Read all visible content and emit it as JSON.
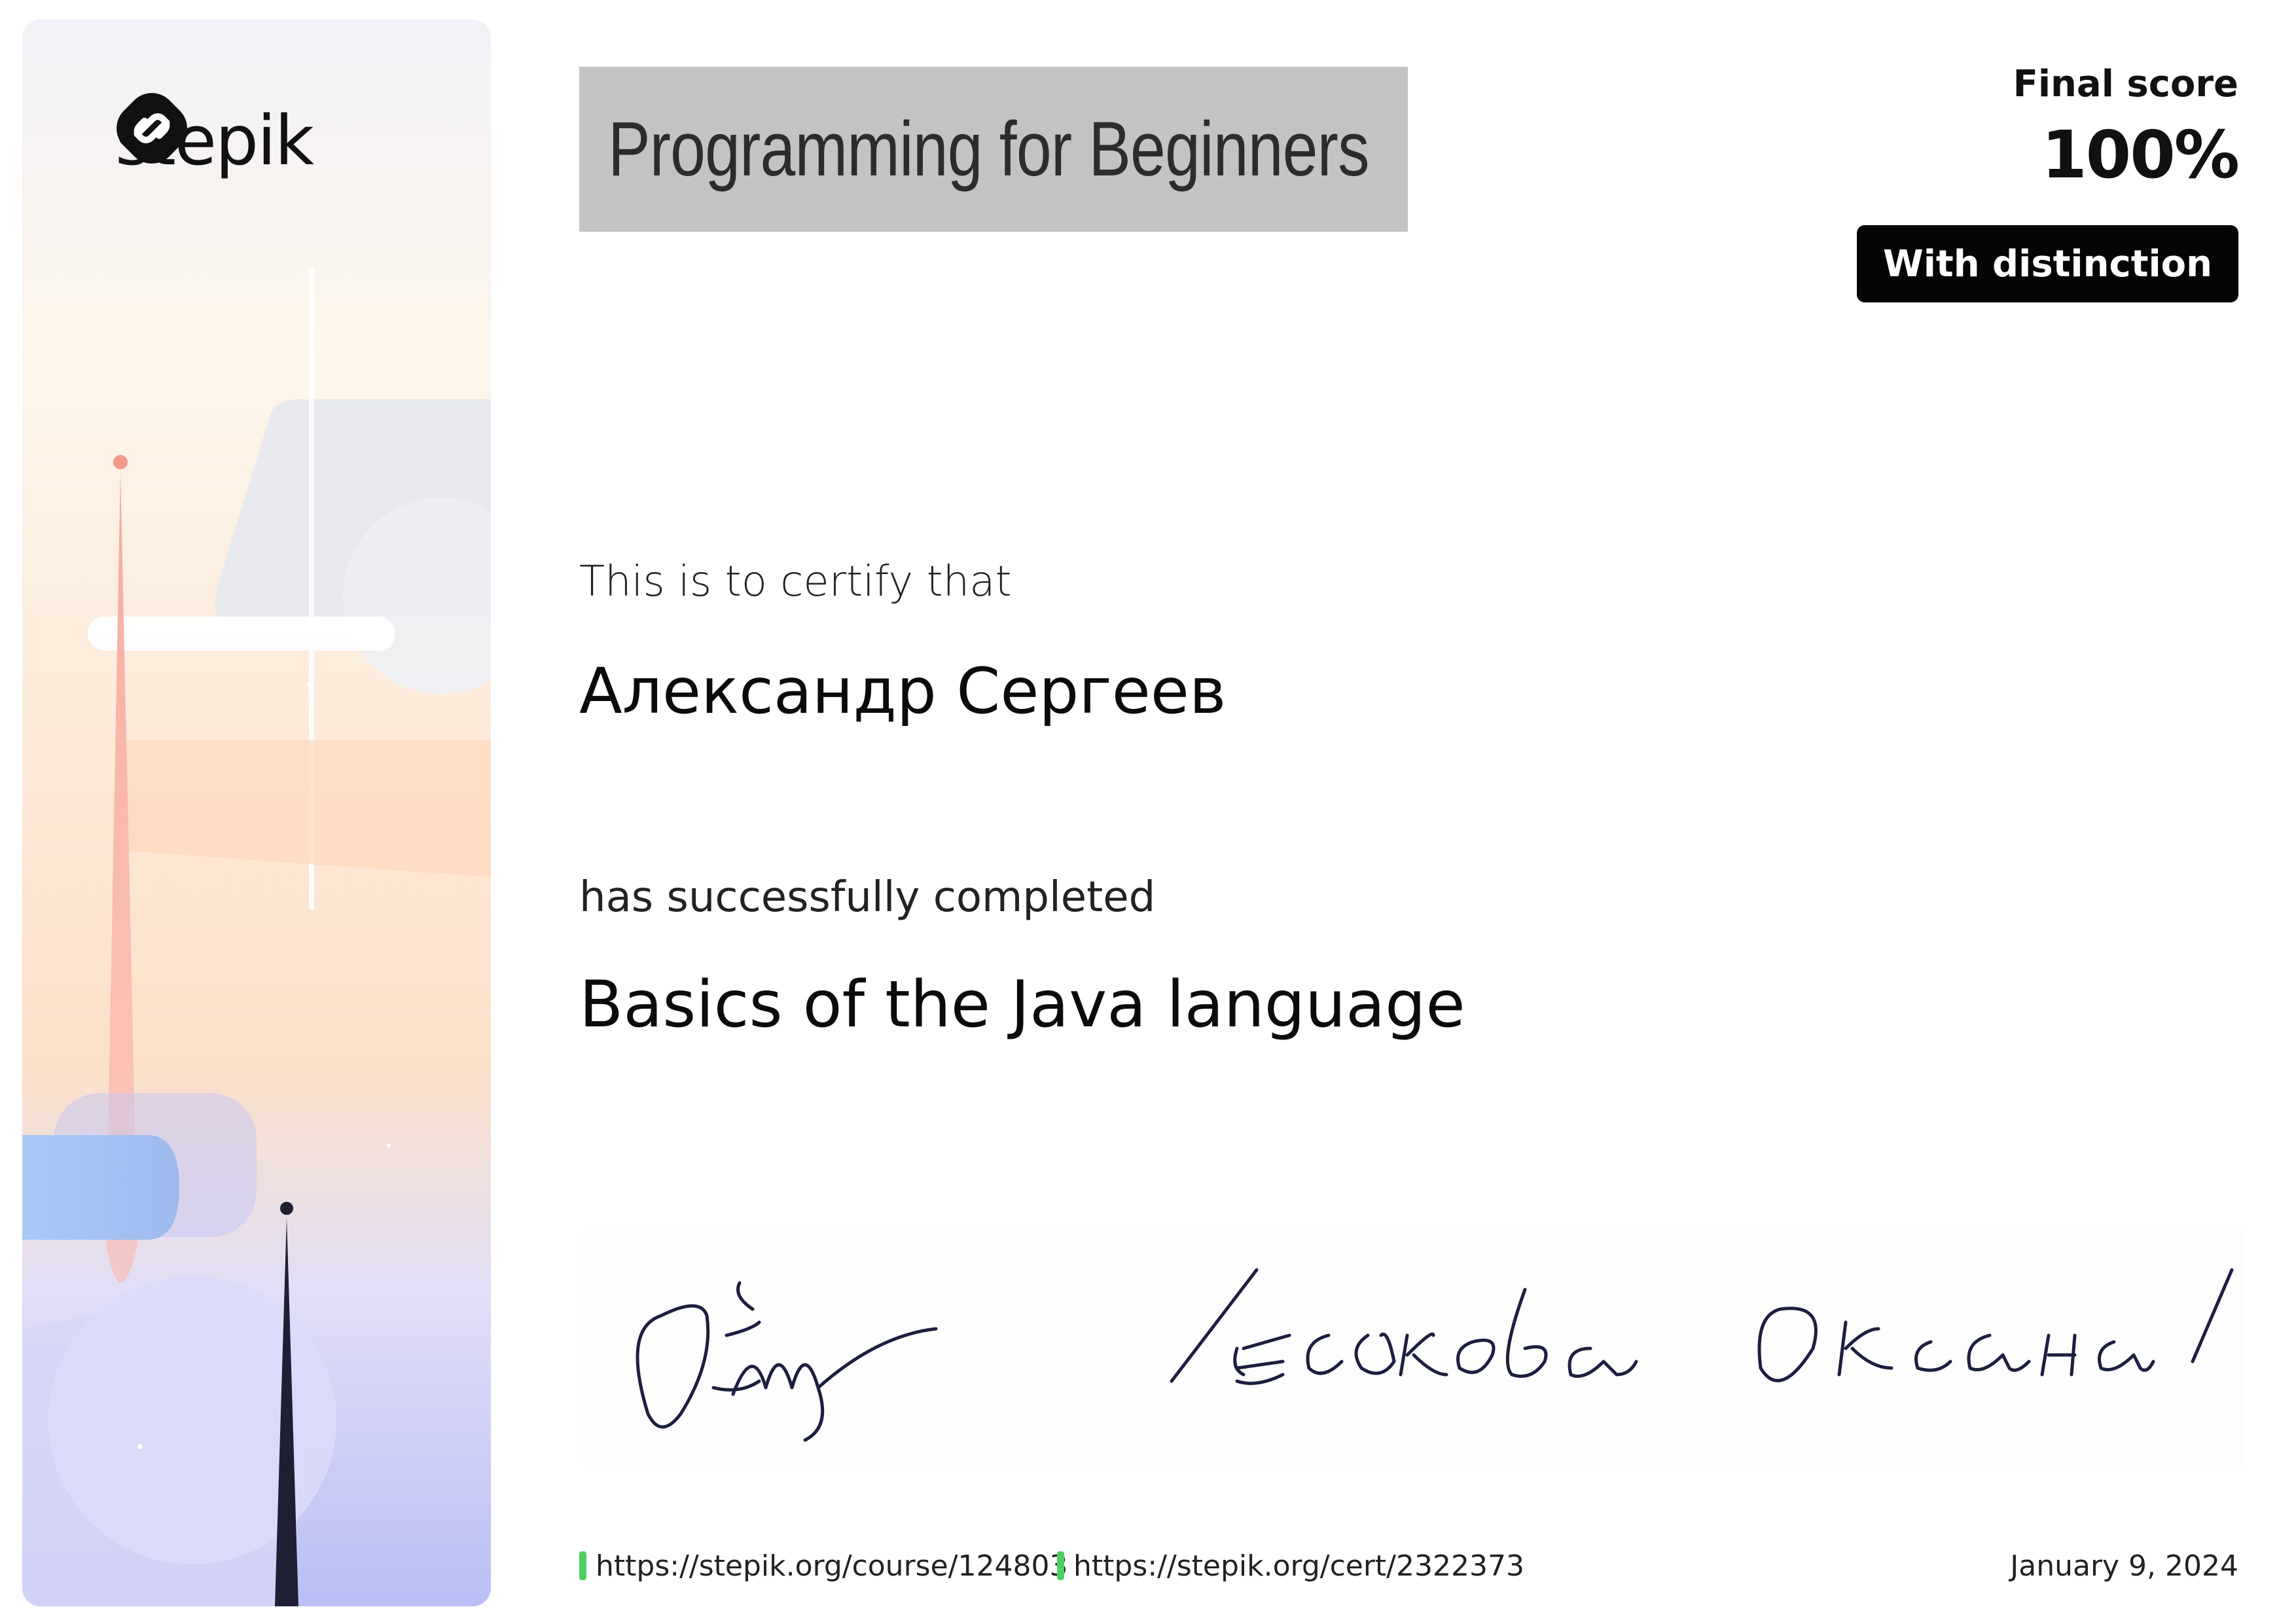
{
  "brand": {
    "name": "stepik",
    "logo_icon": "stepik-logo-icon"
  },
  "course_tag": {
    "text": "Programming for Beginners",
    "background": "#c3c3c3"
  },
  "score": {
    "label": "Final score",
    "value": "100%",
    "badge": "With distinction"
  },
  "certificate": {
    "intro": "This is to certify that",
    "recipient": "Александр Сергеев",
    "completion_text": "has successfully completed",
    "course_title": "Basics of the Java language"
  },
  "signature": {
    "text": "Оксана Теськова Оксана",
    "ink_color": "#1c1f3f"
  },
  "footer": {
    "course_url": "https://stepik.org/course/124803",
    "cert_url": "https://stepik.org/cert/2322373",
    "date": "January 9, 2024",
    "link_marker_color": "#4fcf63"
  }
}
